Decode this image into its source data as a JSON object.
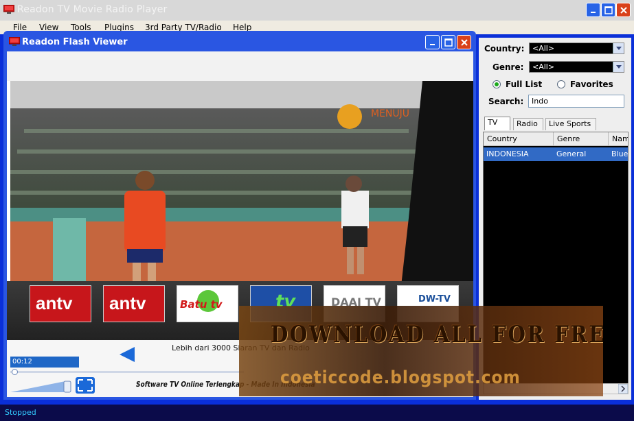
{
  "window": {
    "title": "Readon TV Movie Radio Player"
  },
  "menu": {
    "items": [
      "File",
      "View",
      "Tools",
      "Plugins",
      "3rd Party TV/Radio",
      "Help"
    ]
  },
  "viewer": {
    "title": "Readon Flash Viewer",
    "time": "00:12",
    "info_text": "Lebih dari 3000 Siaran TV dan Radio",
    "footer_text": "Software TV Online Terlengkap - Made In Indonesia"
  },
  "channels": [
    {
      "name": "antv-logo",
      "label": "antv"
    },
    {
      "name": "antv-logo",
      "label": "antv"
    },
    {
      "name": "batu-tv-logo",
      "label": "Batu tv"
    },
    {
      "name": "banten-tv-logo",
      "label": "tv"
    },
    {
      "name": "daai-tv-logo",
      "label": "DAAI TV"
    },
    {
      "name": "dw-tv-logo",
      "label": "DW-TV"
    }
  ],
  "filter": {
    "country_label": "Country:",
    "country_value": "<All>",
    "genre_label": "Genre:",
    "genre_value": "<All>",
    "full_list_label": "Full List",
    "favorites_label": "Favorites",
    "search_label": "Search:",
    "search_value": "Indo"
  },
  "tabs": [
    "TV",
    "Radio",
    "Live Sports"
  ],
  "grid": {
    "columns": [
      "Country",
      "Genre",
      "Nam"
    ],
    "rows": [
      [
        "INDONESIA",
        "General",
        "Blue"
      ]
    ]
  },
  "status": {
    "text": "Stopped"
  },
  "watermark": {
    "line1": "DOWNLOAD ALL FOR FREE",
    "line2": "coeticcode.blogspot.com"
  },
  "colors": {
    "window_frame": "#0a2fd8",
    "selection": "#316ac5",
    "status_text": "#33ccff"
  },
  "icons": [
    "tv-app-icon",
    "minimize-icon",
    "maximize-icon",
    "close-icon",
    "play-prev-icon",
    "fullscreen-icon",
    "dropdown-arrow-icon",
    "scroll-left-icon",
    "scroll-right-icon"
  ]
}
